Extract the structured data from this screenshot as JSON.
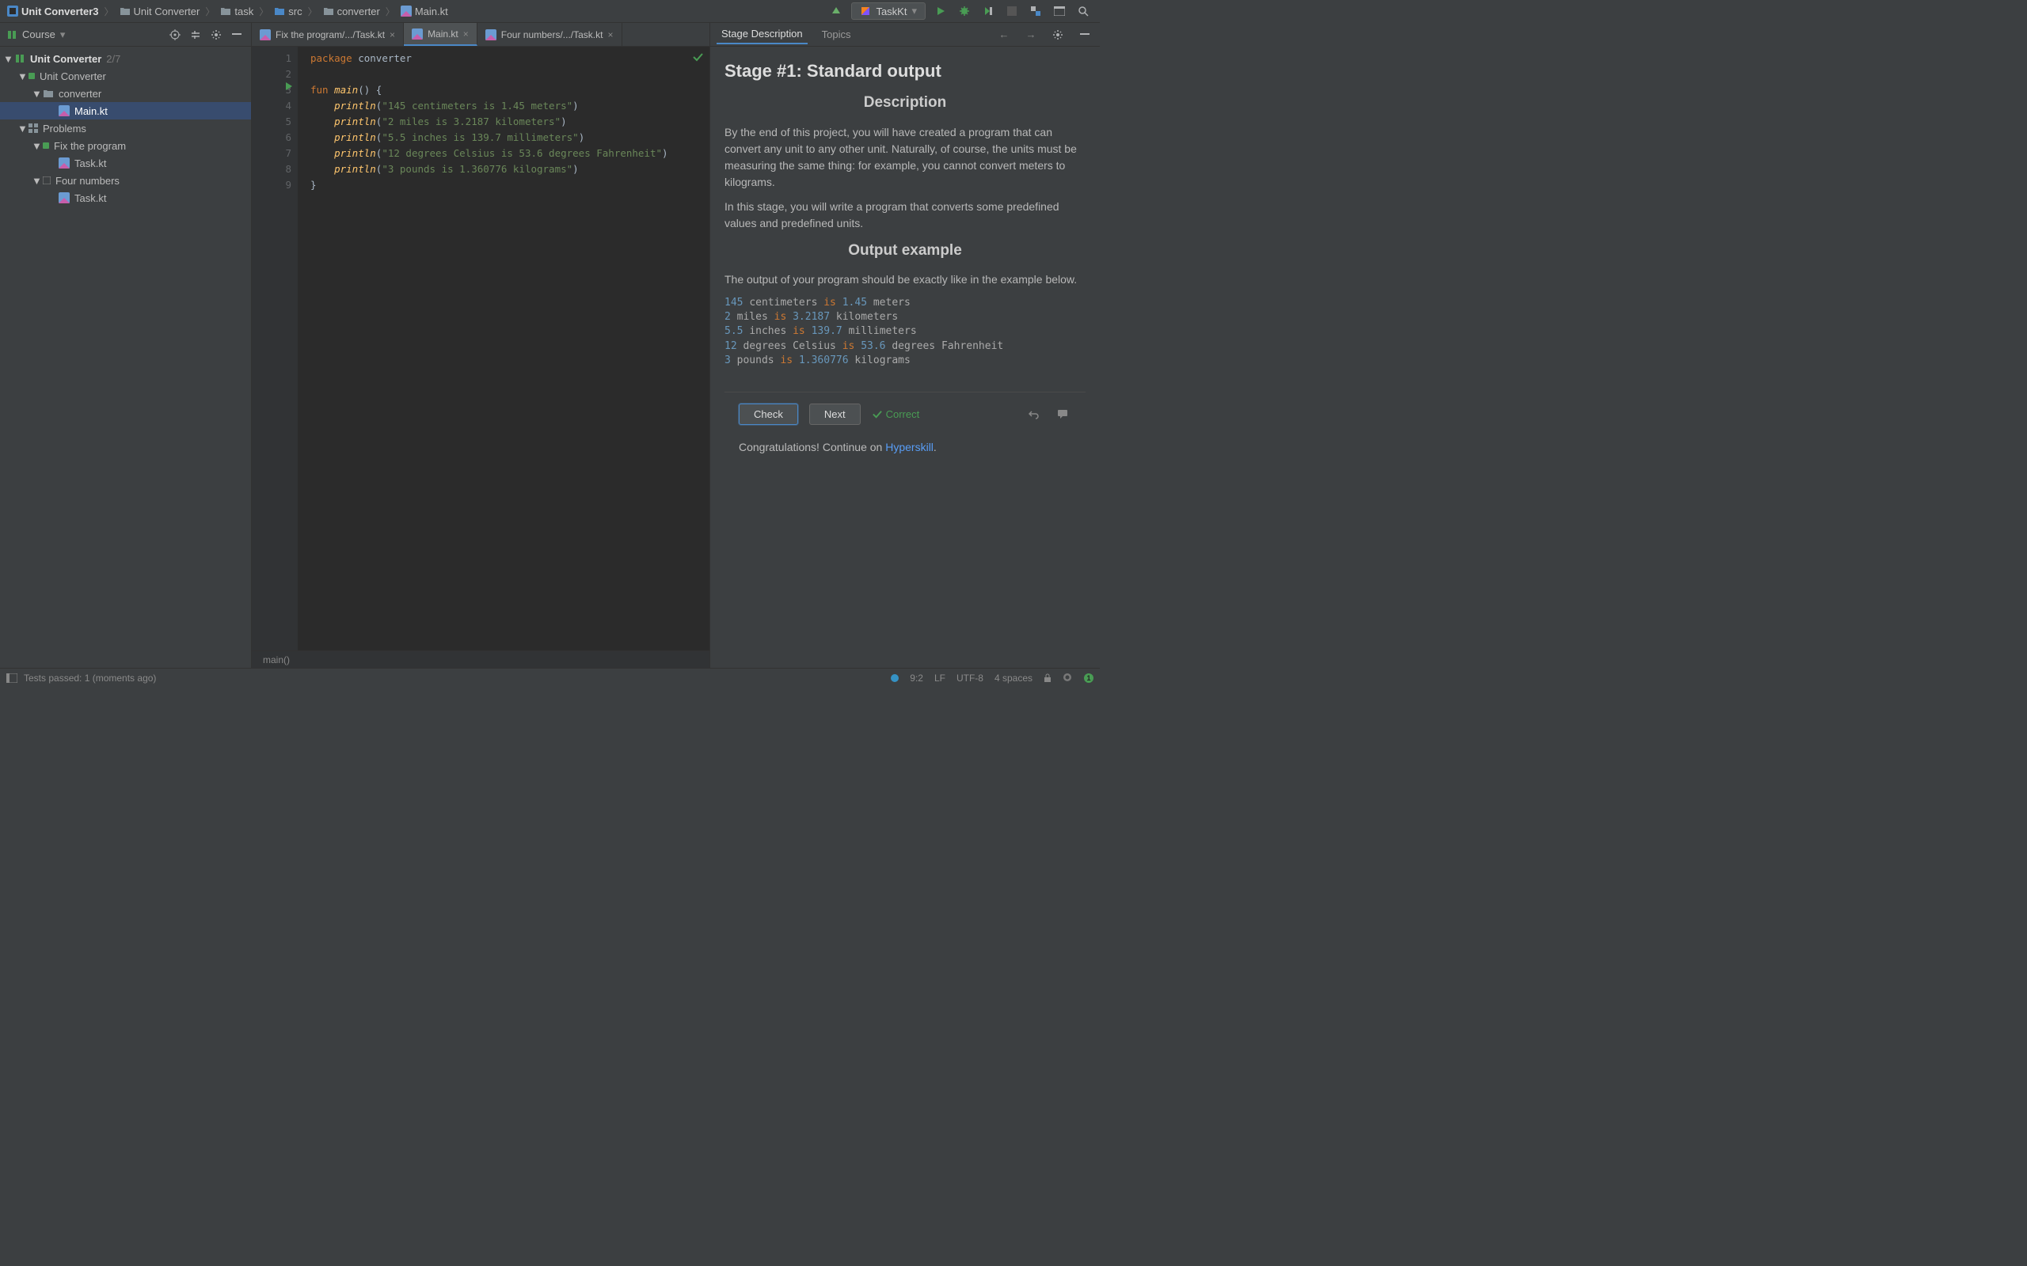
{
  "breadcrumb": [
    "Unit Converter3",
    "Unit Converter",
    "task",
    "src",
    "converter",
    "Main.kt"
  ],
  "toolbar": {
    "run_config": "TaskKt"
  },
  "sidebar": {
    "title": "Course",
    "tree": {
      "project": "Unit Converter",
      "project_count": "2/7",
      "stage": "Unit Converter",
      "pkg": "converter",
      "file": "Main.kt",
      "problems": "Problems",
      "p1": "Fix the program",
      "p1_file": "Task.kt",
      "p2": "Four numbers",
      "p2_file": "Task.kt"
    }
  },
  "tabs": {
    "t1": "Fix the program/.../Task.kt",
    "t2": "Main.kt",
    "t3": "Four numbers/.../Task.kt"
  },
  "code": {
    "lines": [
      "1",
      "2",
      "3",
      "4",
      "5",
      "6",
      "7",
      "8",
      "9"
    ],
    "text_html": "<span class='kw'>package</span> converter\n\n<span class='kw'>fun</span> <span class='fn'>main</span>() <span class='brace'>{</span>\n    <span class='fn'>println</span>(<span class='str'>\"145 centimeters is 1.45 meters\"</span>)\n    <span class='fn'>println</span>(<span class='str'>\"2 miles is 3.2187 kilometers\"</span>)\n    <span class='fn'>println</span>(<span class='str'>\"5.5 inches is 139.7 millimeters\"</span>)\n    <span class='fn'>println</span>(<span class='str'>\"12 degrees Celsius is 53.6 degrees Fahrenheit\"</span>)\n    <span class='fn'>println</span>(<span class='str'>\"3 pounds is 1.360776 kilograms\"</span>)\n<span class='brace'>}</span>",
    "footer": "main()"
  },
  "right": {
    "tab1": "Stage Description",
    "tab2": "Topics",
    "h1": "Stage #1: Standard output",
    "h2a": "Description",
    "p1": "By the end of this project, you will have created a program that can convert any unit to any other unit. Naturally, of course, the units must be measuring the same thing: for example, you cannot convert meters to kilograms.",
    "p2": "In this stage, you will write a program that converts some predefined values and predefined units.",
    "h2b": "Output example",
    "p3": "The output of your program should be exactly like in the example below.",
    "example_html": "<span class='num'>145</span> <span class='txtc'>centimeters</span> <span class='op-is'>is</span> <span class='num'>1.45</span> <span class='txtc'>meters</span>\n<span class='num'>2</span> <span class='txtc'>miles</span> <span class='op-is'>is</span> <span class='num'>3.2187</span> <span class='txtc'>kilometers</span>\n<span class='num'>5.5</span> <span class='txtc'>inches</span> <span class='op-is'>is</span> <span class='num'>139.7</span> <span class='txtc'>millimeters</span>\n<span class='num'>12</span> <span class='txtc'>degrees Celsius</span> <span class='op-is'>is</span> <span class='num'>53.6</span> <span class='txtc'>degrees Fahrenheit</span>\n<span class='num'>3</span> <span class='txtc'>pounds</span> <span class='op-is'>is</span> <span class='num'>1.360776</span> <span class='txtc'>kilograms</span>",
    "btn_check": "Check",
    "btn_next": "Next",
    "status": "Correct",
    "congrats_pre": "Congratulations! Continue on ",
    "congrats_link": "Hyperskill"
  },
  "statusbar": {
    "tests": "Tests passed: 1 (moments ago)",
    "pos": "9:2",
    "le": "LF",
    "enc": "UTF-8",
    "indent": "4 spaces",
    "notif": "1"
  }
}
